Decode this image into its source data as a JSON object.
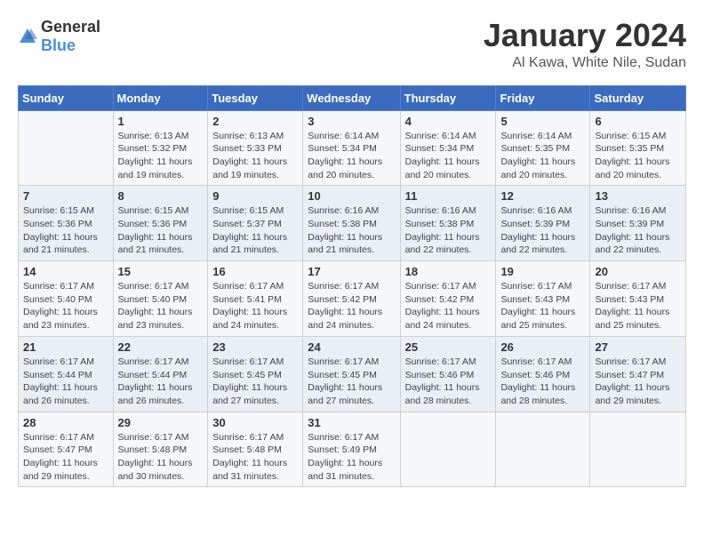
{
  "logo": {
    "general": "General",
    "blue": "Blue"
  },
  "title": "January 2024",
  "subtitle": "Al Kawa, White Nile, Sudan",
  "columns": [
    "Sunday",
    "Monday",
    "Tuesday",
    "Wednesday",
    "Thursday",
    "Friday",
    "Saturday"
  ],
  "weeks": [
    [
      {
        "day": "",
        "sunrise": "",
        "sunset": "",
        "daylight": ""
      },
      {
        "day": "1",
        "sunrise": "Sunrise: 6:13 AM",
        "sunset": "Sunset: 5:32 PM",
        "daylight": "Daylight: 11 hours and 19 minutes."
      },
      {
        "day": "2",
        "sunrise": "Sunrise: 6:13 AM",
        "sunset": "Sunset: 5:33 PM",
        "daylight": "Daylight: 11 hours and 19 minutes."
      },
      {
        "day": "3",
        "sunrise": "Sunrise: 6:14 AM",
        "sunset": "Sunset: 5:34 PM",
        "daylight": "Daylight: 11 hours and 20 minutes."
      },
      {
        "day": "4",
        "sunrise": "Sunrise: 6:14 AM",
        "sunset": "Sunset: 5:34 PM",
        "daylight": "Daylight: 11 hours and 20 minutes."
      },
      {
        "day": "5",
        "sunrise": "Sunrise: 6:14 AM",
        "sunset": "Sunset: 5:35 PM",
        "daylight": "Daylight: 11 hours and 20 minutes."
      },
      {
        "day": "6",
        "sunrise": "Sunrise: 6:15 AM",
        "sunset": "Sunset: 5:35 PM",
        "daylight": "Daylight: 11 hours and 20 minutes."
      }
    ],
    [
      {
        "day": "7",
        "sunrise": "Sunrise: 6:15 AM",
        "sunset": "Sunset: 5:36 PM",
        "daylight": "Daylight: 11 hours and 21 minutes."
      },
      {
        "day": "8",
        "sunrise": "Sunrise: 6:15 AM",
        "sunset": "Sunset: 5:36 PM",
        "daylight": "Daylight: 11 hours and 21 minutes."
      },
      {
        "day": "9",
        "sunrise": "Sunrise: 6:15 AM",
        "sunset": "Sunset: 5:37 PM",
        "daylight": "Daylight: 11 hours and 21 minutes."
      },
      {
        "day": "10",
        "sunrise": "Sunrise: 6:16 AM",
        "sunset": "Sunset: 5:38 PM",
        "daylight": "Daylight: 11 hours and 21 minutes."
      },
      {
        "day": "11",
        "sunrise": "Sunrise: 6:16 AM",
        "sunset": "Sunset: 5:38 PM",
        "daylight": "Daylight: 11 hours and 22 minutes."
      },
      {
        "day": "12",
        "sunrise": "Sunrise: 6:16 AM",
        "sunset": "Sunset: 5:39 PM",
        "daylight": "Daylight: 11 hours and 22 minutes."
      },
      {
        "day": "13",
        "sunrise": "Sunrise: 6:16 AM",
        "sunset": "Sunset: 5:39 PM",
        "daylight": "Daylight: 11 hours and 22 minutes."
      }
    ],
    [
      {
        "day": "14",
        "sunrise": "Sunrise: 6:17 AM",
        "sunset": "Sunset: 5:40 PM",
        "daylight": "Daylight: 11 hours and 23 minutes."
      },
      {
        "day": "15",
        "sunrise": "Sunrise: 6:17 AM",
        "sunset": "Sunset: 5:40 PM",
        "daylight": "Daylight: 11 hours and 23 minutes."
      },
      {
        "day": "16",
        "sunrise": "Sunrise: 6:17 AM",
        "sunset": "Sunset: 5:41 PM",
        "daylight": "Daylight: 11 hours and 24 minutes."
      },
      {
        "day": "17",
        "sunrise": "Sunrise: 6:17 AM",
        "sunset": "Sunset: 5:42 PM",
        "daylight": "Daylight: 11 hours and 24 minutes."
      },
      {
        "day": "18",
        "sunrise": "Sunrise: 6:17 AM",
        "sunset": "Sunset: 5:42 PM",
        "daylight": "Daylight: 11 hours and 24 minutes."
      },
      {
        "day": "19",
        "sunrise": "Sunrise: 6:17 AM",
        "sunset": "Sunset: 5:43 PM",
        "daylight": "Daylight: 11 hours and 25 minutes."
      },
      {
        "day": "20",
        "sunrise": "Sunrise: 6:17 AM",
        "sunset": "Sunset: 5:43 PM",
        "daylight": "Daylight: 11 hours and 25 minutes."
      }
    ],
    [
      {
        "day": "21",
        "sunrise": "Sunrise: 6:17 AM",
        "sunset": "Sunset: 5:44 PM",
        "daylight": "Daylight: 11 hours and 26 minutes."
      },
      {
        "day": "22",
        "sunrise": "Sunrise: 6:17 AM",
        "sunset": "Sunset: 5:44 PM",
        "daylight": "Daylight: 11 hours and 26 minutes."
      },
      {
        "day": "23",
        "sunrise": "Sunrise: 6:17 AM",
        "sunset": "Sunset: 5:45 PM",
        "daylight": "Daylight: 11 hours and 27 minutes."
      },
      {
        "day": "24",
        "sunrise": "Sunrise: 6:17 AM",
        "sunset": "Sunset: 5:45 PM",
        "daylight": "Daylight: 11 hours and 27 minutes."
      },
      {
        "day": "25",
        "sunrise": "Sunrise: 6:17 AM",
        "sunset": "Sunset: 5:46 PM",
        "daylight": "Daylight: 11 hours and 28 minutes."
      },
      {
        "day": "26",
        "sunrise": "Sunrise: 6:17 AM",
        "sunset": "Sunset: 5:46 PM",
        "daylight": "Daylight: 11 hours and 28 minutes."
      },
      {
        "day": "27",
        "sunrise": "Sunrise: 6:17 AM",
        "sunset": "Sunset: 5:47 PM",
        "daylight": "Daylight: 11 hours and 29 minutes."
      }
    ],
    [
      {
        "day": "28",
        "sunrise": "Sunrise: 6:17 AM",
        "sunset": "Sunset: 5:47 PM",
        "daylight": "Daylight: 11 hours and 29 minutes."
      },
      {
        "day": "29",
        "sunrise": "Sunrise: 6:17 AM",
        "sunset": "Sunset: 5:48 PM",
        "daylight": "Daylight: 11 hours and 30 minutes."
      },
      {
        "day": "30",
        "sunrise": "Sunrise: 6:17 AM",
        "sunset": "Sunset: 5:48 PM",
        "daylight": "Daylight: 11 hours and 31 minutes."
      },
      {
        "day": "31",
        "sunrise": "Sunrise: 6:17 AM",
        "sunset": "Sunset: 5:49 PM",
        "daylight": "Daylight: 11 hours and 31 minutes."
      },
      {
        "day": "",
        "sunrise": "",
        "sunset": "",
        "daylight": ""
      },
      {
        "day": "",
        "sunrise": "",
        "sunset": "",
        "daylight": ""
      },
      {
        "day": "",
        "sunrise": "",
        "sunset": "",
        "daylight": ""
      }
    ]
  ]
}
